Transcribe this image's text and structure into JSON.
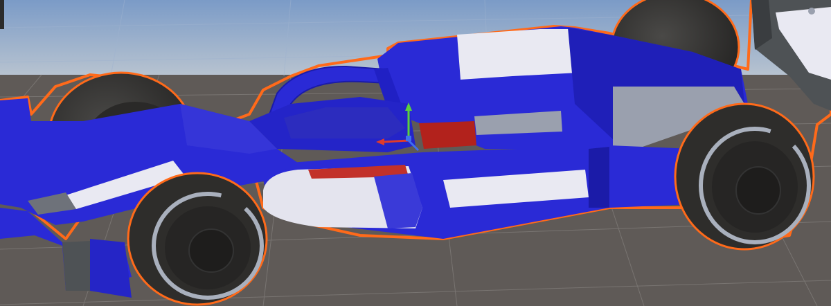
{
  "scene": {
    "skybox_top": "#7f9fc9",
    "skybox_horizon": "#b7c3cf",
    "ground": "#5f5a57",
    "grid_line": "#8a8683"
  },
  "selection": {
    "outline_color": "#ff6a1a"
  },
  "car": {
    "livery_blue": "#2a2ad6",
    "livery_dark_blue": "#1b1ba8",
    "livery_white": "#e9e9f2",
    "livery_grey": "#9aa0ae",
    "livery_red": "#b2221c",
    "tyre": "#2e2d2b",
    "tyre_side": "#3a3a38",
    "rim_stripe": "#a9b0bd",
    "wing": "#4e5255"
  },
  "gizmo": {
    "y_axis_color": "#5bd13d",
    "x_axis_color": "#e03b2b",
    "z_axis_color": "#3f6ff0"
  }
}
